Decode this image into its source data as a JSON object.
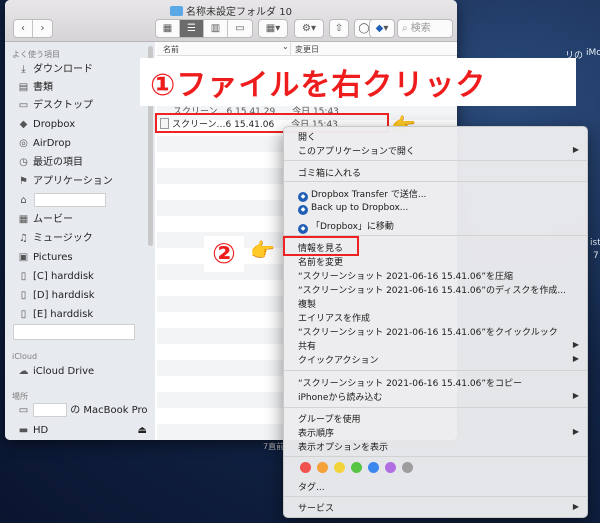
{
  "window": {
    "title": "名称未設定フォルダ 10",
    "search_placeholder": "検索",
    "nav_back": "‹",
    "nav_forward": "›",
    "gear": "⚙",
    "share": "⇧",
    "dropbox": "◆"
  },
  "sidebar": {
    "favorites_header": "よく使う項目",
    "items": [
      {
        "icon": "⤓",
        "label": "ダウンロード"
      },
      {
        "icon": "▤",
        "label": "書類"
      },
      {
        "icon": "▭",
        "label": "デスクトップ"
      },
      {
        "icon": "◆",
        "label": "Dropbox"
      },
      {
        "icon": "◎",
        "label": "AirDrop"
      },
      {
        "icon": "◷",
        "label": "最近の項目"
      },
      {
        "icon": "⚑",
        "label": "アプリケーション"
      },
      {
        "icon": "⌂",
        "label": ""
      },
      {
        "icon": "▦",
        "label": "ムービー"
      },
      {
        "icon": "♫",
        "label": "ミュージック"
      },
      {
        "icon": "▣",
        "label": "Pictures"
      },
      {
        "icon": "▯",
        "label": "[C] harddisk"
      },
      {
        "icon": "▯",
        "label": "[D] harddisk"
      },
      {
        "icon": "▯",
        "label": "[E] harddisk"
      }
    ],
    "icloud_header": "iCloud",
    "icloud_drive": "iCloud Drive",
    "locations_header": "場所",
    "macbook_suffix": "の MacBook Pro",
    "hd": "HD",
    "eject": "⏏"
  },
  "list": {
    "col_name": "名前",
    "col_modified": "変更日",
    "file1_name": "スクリーン…6 15.41.29",
    "file1_date": "今日 15:43",
    "file2_name": "スクリーン…6 15.41.06",
    "file2_date": "今日 15:43"
  },
  "callout": {
    "step1": "①ファイルを右クリック",
    "step2": "②"
  },
  "menu": {
    "open": "開く",
    "open_with": "このアプリケーションで開く",
    "trash": "ゴミ箱に入れる",
    "dropbox_send": "Dropbox Transfer で送信...",
    "dropbox_backup": "Back up to Dropbox...",
    "dropbox_move": "「Dropbox」に移動",
    "get_info": "情報を見る",
    "rename": "名前を変更",
    "compress": "“スクリーンショット 2021-06-16 15.41.06”を圧縮",
    "burn": "“スクリーンショット 2021-06-16 15.41.06”のディスクを作成...",
    "duplicate": "複製",
    "alias": "エイリアスを作成",
    "quicklook": "“スクリーンショット 2021-06-16 15.41.06”をクイックルック",
    "share": "共有",
    "quick_actions": "クイックアクション",
    "copy": "“スクリーンショット 2021-06-16 15.41.06”をコピー",
    "import_iphone": "iPhoneから読み込む",
    "use_groups": "グループを使用",
    "sort_by": "表示順序",
    "view_options": "表示オプションを表示",
    "tags": "タグ...",
    "services": "サービス",
    "tag_colors": [
      "#f0524e",
      "#f4a13a",
      "#f2d33b",
      "#57c443",
      "#3b87f0",
      "#b16ee0",
      "#9d9d9d"
    ]
  },
  "desktop": {
    "edge1": "リの",
    "edge2": "iMo",
    "edge3": "ist",
    "edge4": "7",
    "edge5": "7直前"
  }
}
